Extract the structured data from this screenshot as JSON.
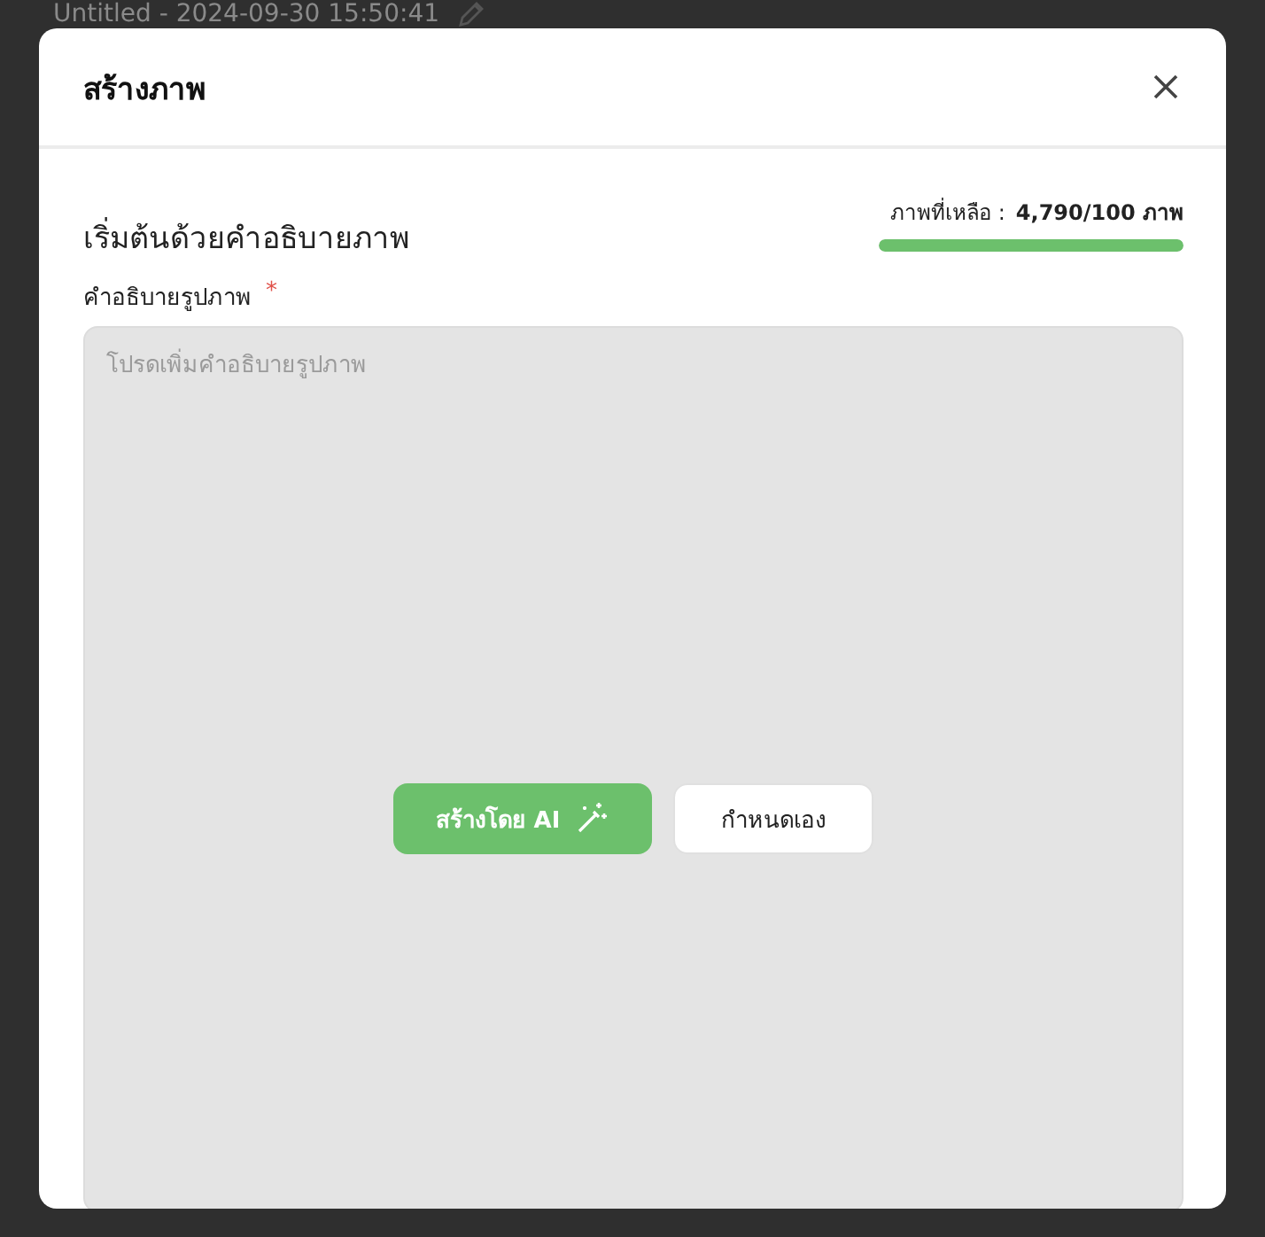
{
  "background": {
    "document_title": "Untitled - 2024-09-30 15:50:41"
  },
  "dialog": {
    "title": "สร้างภาพ",
    "section_title": "เริ่มต้นด้วยคำอธิบายภาพ",
    "quota": {
      "label": "ภาพที่เหลือ :",
      "value": "4,790/100 ภาพ",
      "level": 1
    },
    "field": {
      "label": "คำอธิบายรูปภาพ",
      "required": true,
      "required_mark": "*",
      "placeholder": "โปรดเพิ่มคำอธิบายรูปภาพ"
    },
    "buttons": [
      {
        "label": "สร้างโดย AI",
        "kind": "primary"
      },
      {
        "label": "กำหนดเอง",
        "kind": "secondary"
      }
    ]
  }
}
